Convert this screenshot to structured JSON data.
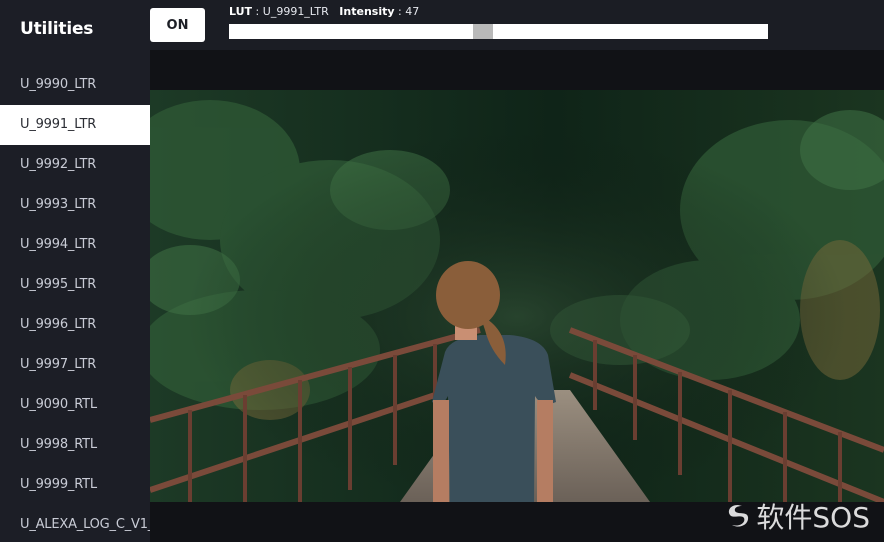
{
  "sidebar": {
    "title": "Utilities",
    "items": [
      {
        "label": "U_9990_LTR"
      },
      {
        "label": "U_9991_LTR",
        "active": true
      },
      {
        "label": "U_9992_LTR"
      },
      {
        "label": "U_9993_LTR"
      },
      {
        "label": "U_9994_LTR"
      },
      {
        "label": "U_9995_LTR"
      },
      {
        "label": "U_9996_LTR"
      },
      {
        "label": "U_9997_LTR"
      },
      {
        "label": "U_9090_RTL"
      },
      {
        "label": "U_9998_RTL"
      },
      {
        "label": "U_9999_RTL"
      },
      {
        "label": "U_ALEXA_LOG_C_V1_"
      }
    ]
  },
  "toolbar": {
    "on_label": "ON",
    "lut_key": "LUT",
    "lut_value": "U_9991_LTR",
    "intensity_key": "Intensity",
    "intensity_value": "47",
    "intensity_fraction": 0.47
  },
  "watermark": {
    "text": "软件SOS",
    "icon": "swirl-logo-icon"
  },
  "colors": {
    "sidebar_bg": "#1c1e26",
    "active_item_bg": "#ffffff",
    "viewer_bg": "#111216"
  }
}
